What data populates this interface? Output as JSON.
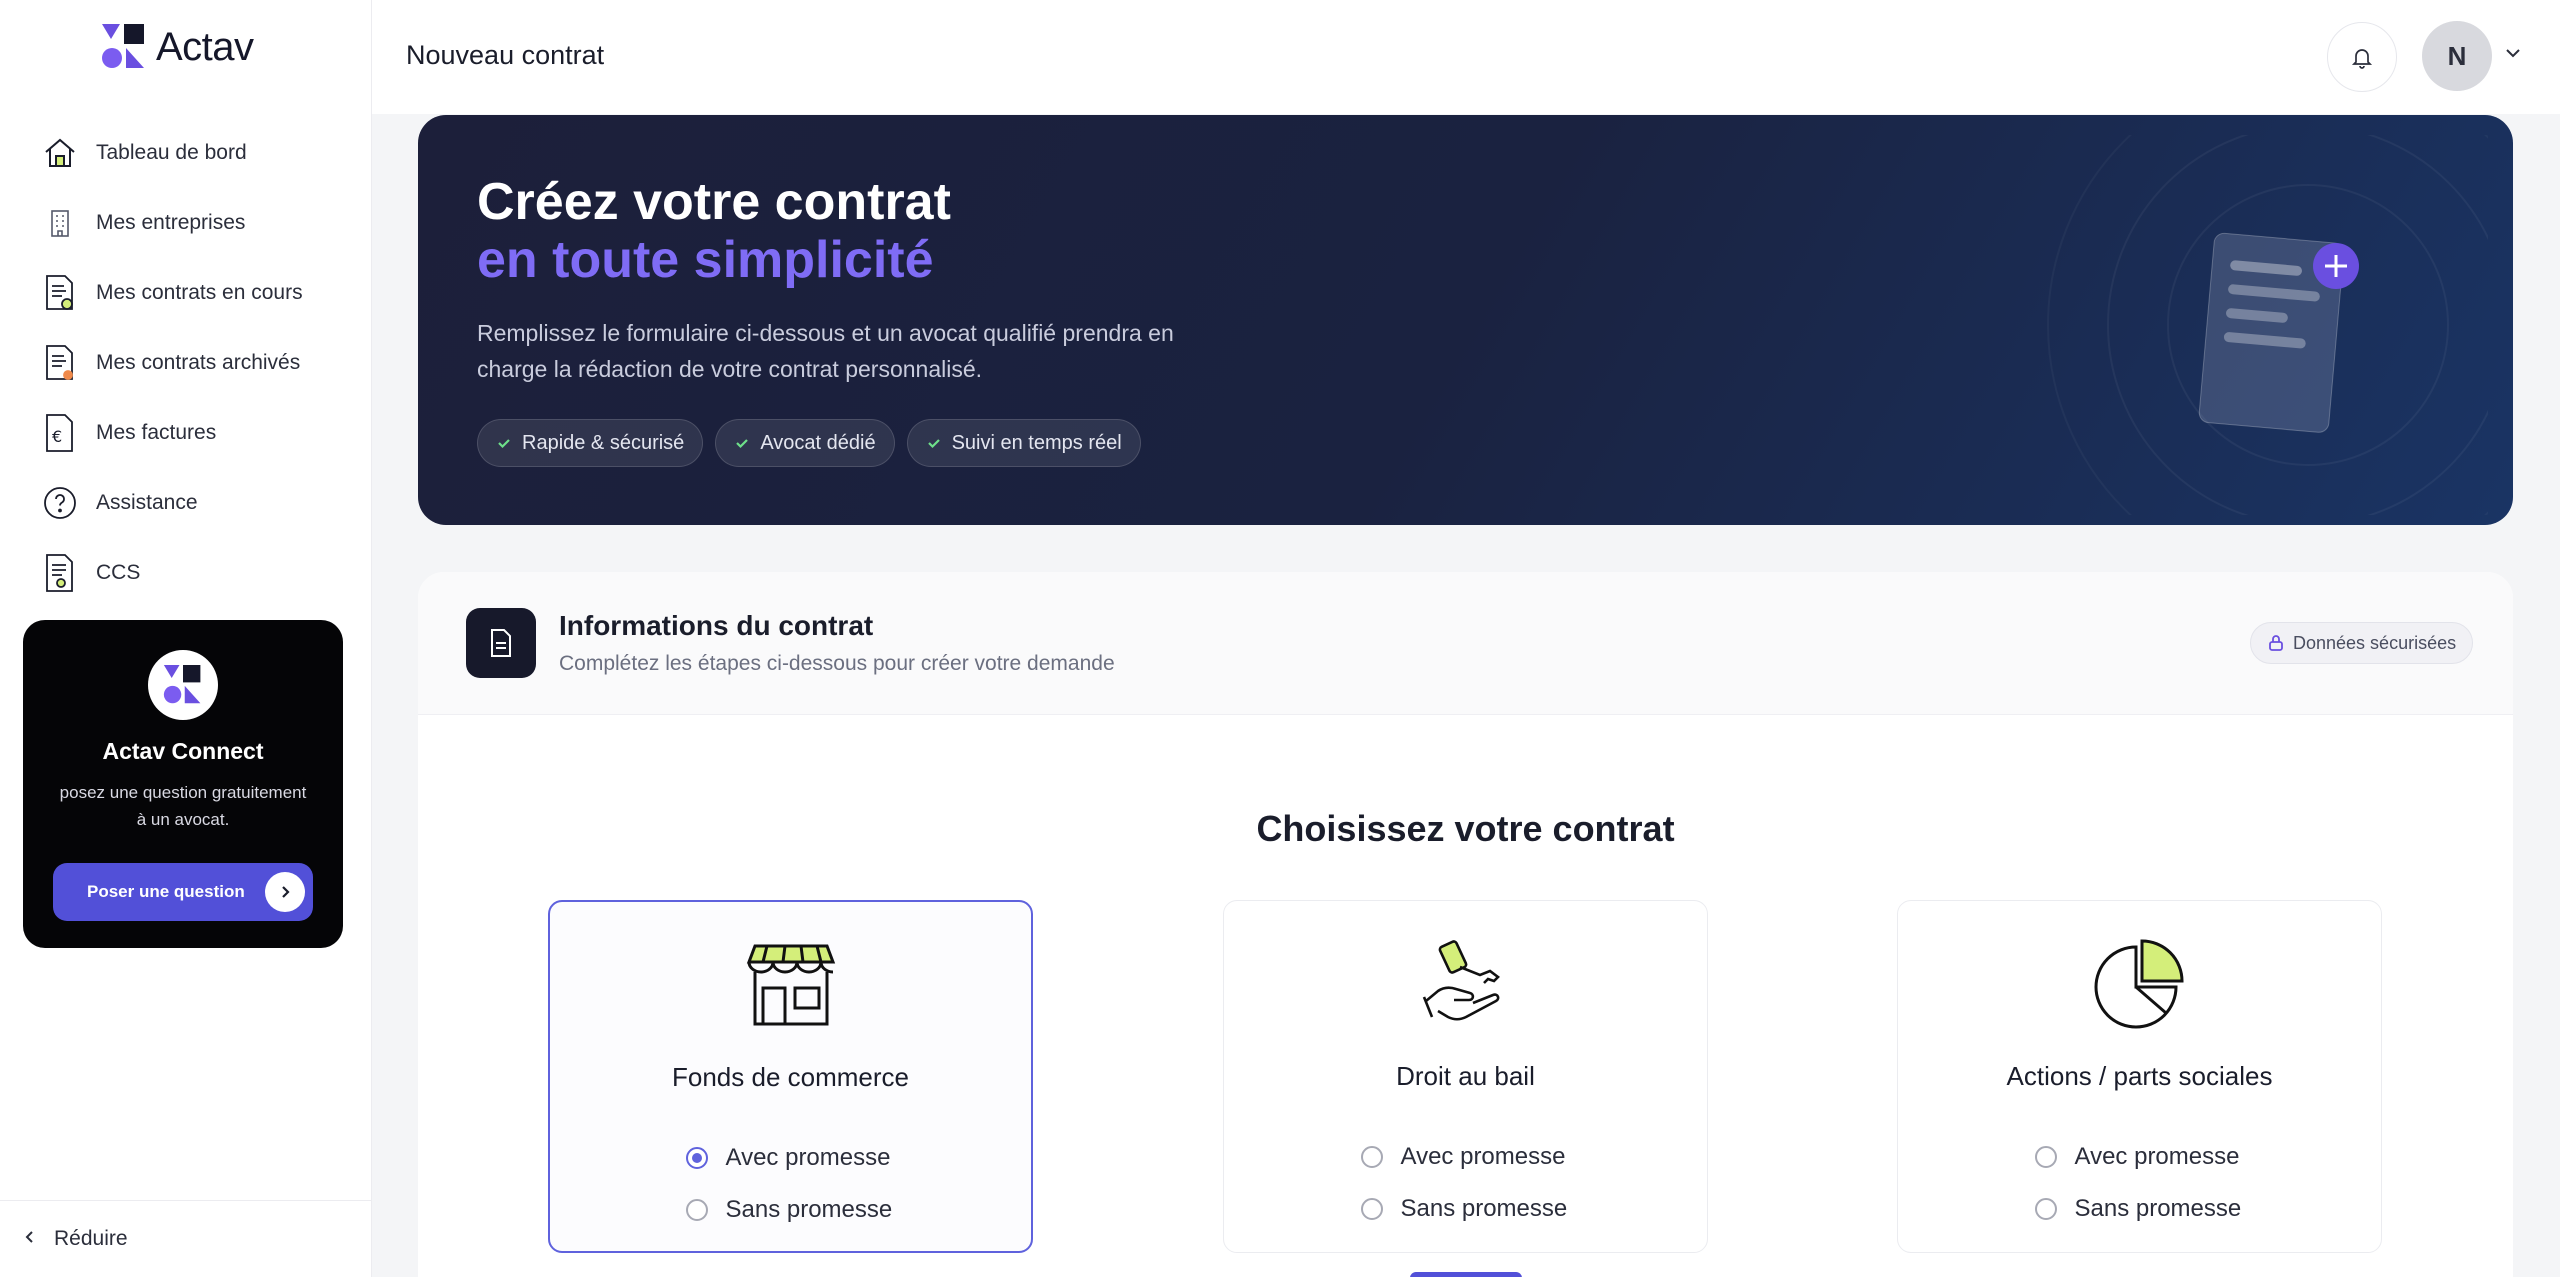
{
  "app": {
    "logo_text": "Actav"
  },
  "sidebar": {
    "items": [
      {
        "label": "Tableau de bord",
        "icon": "home-icon"
      },
      {
        "label": "Mes entreprises",
        "icon": "building-icon"
      },
      {
        "label": "Mes contrats en cours",
        "icon": "contract-pending-icon"
      },
      {
        "label": "Mes contrats archivés",
        "icon": "contract-archive-icon"
      },
      {
        "label": "Mes factures",
        "icon": "invoice-icon"
      },
      {
        "label": "Assistance",
        "icon": "help-icon"
      },
      {
        "label": "CCS",
        "icon": "certificate-icon"
      }
    ],
    "connect": {
      "title": "Actav Connect",
      "description": "posez une question gratuitement à un avocat.",
      "cta": "Poser une question"
    },
    "reduce_label": "Réduire"
  },
  "header": {
    "title": "Nouveau contrat",
    "avatar_initial": "N"
  },
  "hero": {
    "title_line1": "Créez votre contrat",
    "title_line2": "en toute simplicité",
    "subtitle": "Remplissez le formulaire ci-dessous et un avocat qualifié prendra en charge la rédaction de votre contrat personnalisé.",
    "tags": [
      "Rapide & sécurisé",
      "Avocat dédié",
      "Suivi en temps réel"
    ],
    "accent_color": "#7f6cf5"
  },
  "info": {
    "title": "Informations du contrat",
    "subtitle": "Complétez les étapes ci-dessous pour créer votre demande",
    "secure_badge": "Données sécurisées"
  },
  "choose": {
    "title": "Choisissez votre contrat",
    "options": [
      {
        "name": "Fonds de commerce",
        "icon": "storefront-icon",
        "selected": true,
        "choices": [
          "Avec promesse",
          "Sans promesse"
        ],
        "checked": "Avec promesse"
      },
      {
        "name": "Droit au bail",
        "icon": "key-in-hand-icon",
        "selected": false,
        "choices": [
          "Avec promesse",
          "Sans promesse"
        ],
        "checked": null
      },
      {
        "name": "Actions / parts sociales",
        "icon": "pie-chart-icon",
        "selected": false,
        "choices": [
          "Avec promesse",
          "Sans promesse"
        ],
        "checked": null
      }
    ]
  },
  "colors": {
    "primary": "#5f62dd",
    "lime": "#d4ee7a",
    "dark": "#17192b"
  }
}
